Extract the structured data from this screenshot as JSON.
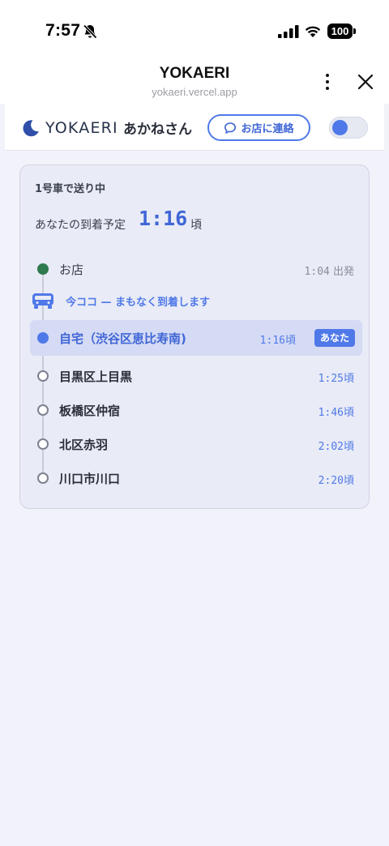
{
  "status_bar": {
    "time": "7:57",
    "battery": "100",
    "icons": [
      "bell-slash-icon",
      "signal-icon",
      "wifi-icon",
      "battery-icon"
    ]
  },
  "browser": {
    "title": "YOKAERI",
    "url": "yokaeri.vercel.app"
  },
  "header": {
    "logo": "YOKAERI",
    "customer_name": "あかねさん",
    "contact_label": "お店に連絡",
    "toggle_on": true
  },
  "card": {
    "car_status": "1号車で送り中",
    "eta_label": "あなたの到着予定",
    "eta_time": "1:16",
    "eta_suffix": "頃",
    "vehicle_status": "今ココ — まもなく到着します",
    "stops": [
      {
        "name": "お店",
        "time": "1:04",
        "suffix": " 出発"
      },
      {
        "name": "自宅（渋谷区恵比寿南)",
        "time": "1:16",
        "suffix": "頃",
        "badge": "あなた"
      },
      {
        "name": "目黒区上目黒",
        "time": "1:25",
        "suffix": "頃"
      },
      {
        "name": "板橋区仲宿",
        "time": "1:46",
        "suffix": "頃"
      },
      {
        "name": "北区赤羽",
        "time": "2:02",
        "suffix": "頃"
      },
      {
        "name": "川口市川口",
        "time": "2:20",
        "suffix": "頃"
      }
    ]
  },
  "colors": {
    "accent": "#4f79e8",
    "origin": "#2f7a4e",
    "background": "#f2f3fa",
    "card": "#e9ebf6"
  }
}
